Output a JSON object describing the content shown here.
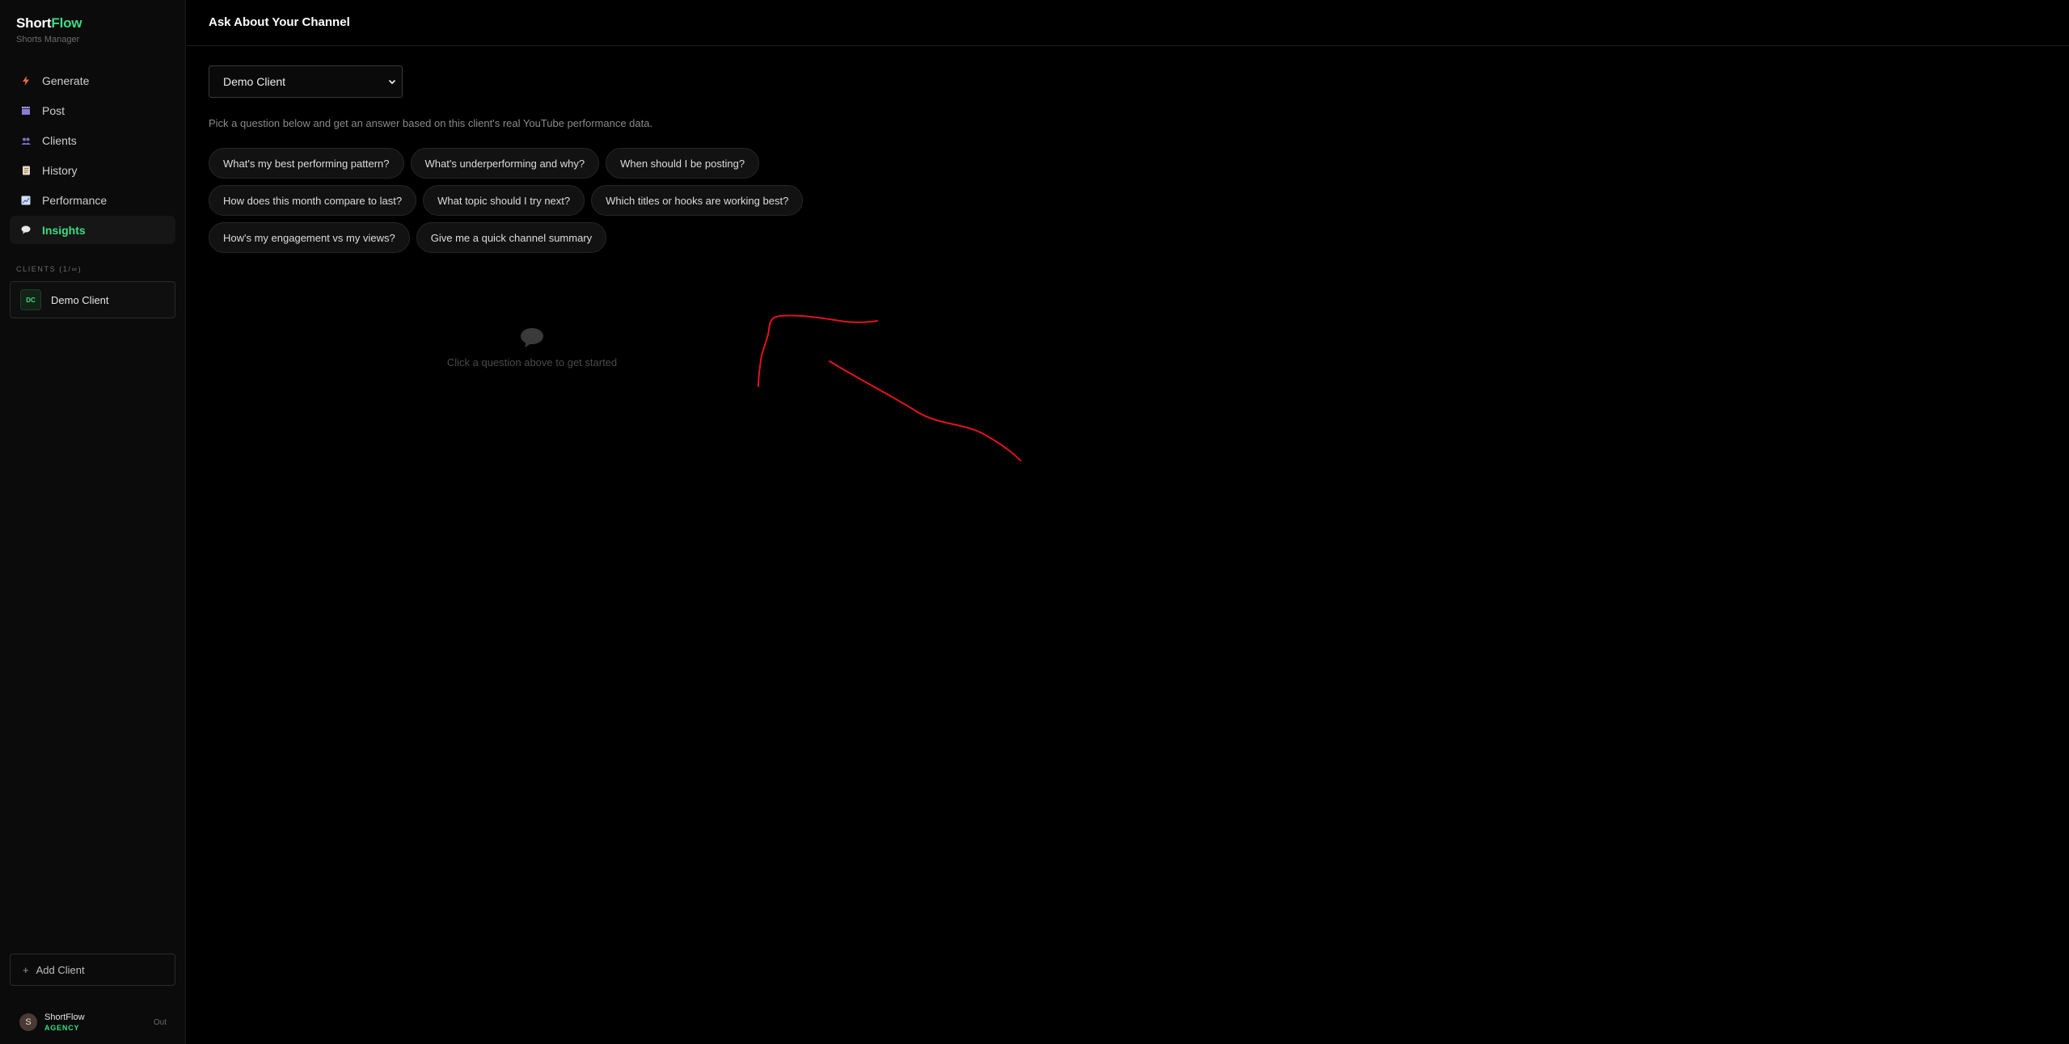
{
  "brand": {
    "name_part1": "Short",
    "name_part2": "Flow",
    "subtitle": "Shorts Manager"
  },
  "nav": [
    {
      "label": "Generate",
      "icon": "lightning-icon",
      "color": "#f06a3c"
    },
    {
      "label": "Post",
      "icon": "clapper-icon",
      "color": "#8a7bd8"
    },
    {
      "label": "Clients",
      "icon": "users-icon",
      "color": "#7a74c8"
    },
    {
      "label": "History",
      "icon": "scroll-icon",
      "color": "#c9a07c"
    },
    {
      "label": "Performance",
      "icon": "chart-icon",
      "color": "#a8b8e0"
    },
    {
      "label": "Insights",
      "icon": "speech-bubble-icon",
      "color": "#e8e8e8",
      "active": true
    }
  ],
  "clients_section": {
    "label": "CLIENTS (1/∞)",
    "items": [
      {
        "initials": "DC",
        "name": "Demo Client"
      }
    ],
    "add_label": "Add Client"
  },
  "user": {
    "initial": "S",
    "name": "ShortFlow",
    "plan": "AGENCY",
    "logout": "Out"
  },
  "header": {
    "title": "Ask About Your Channel"
  },
  "main": {
    "selected_client": "Demo Client",
    "helper_text": "Pick a question below and get an answer based on this client's real YouTube performance data.",
    "questions": [
      [
        "What's my best performing pattern?",
        "What's underperforming and why?",
        "When should I be posting?"
      ],
      [
        "How does this month compare to last?",
        "What topic should I try next?",
        "Which titles or hooks are working best?"
      ],
      [
        "How's my engagement vs my views?",
        "Give me a quick channel summary"
      ]
    ],
    "empty_state": "Click a question above to get started"
  },
  "colors": {
    "accent": "#3ddc84",
    "annotation": "#e0141e"
  }
}
